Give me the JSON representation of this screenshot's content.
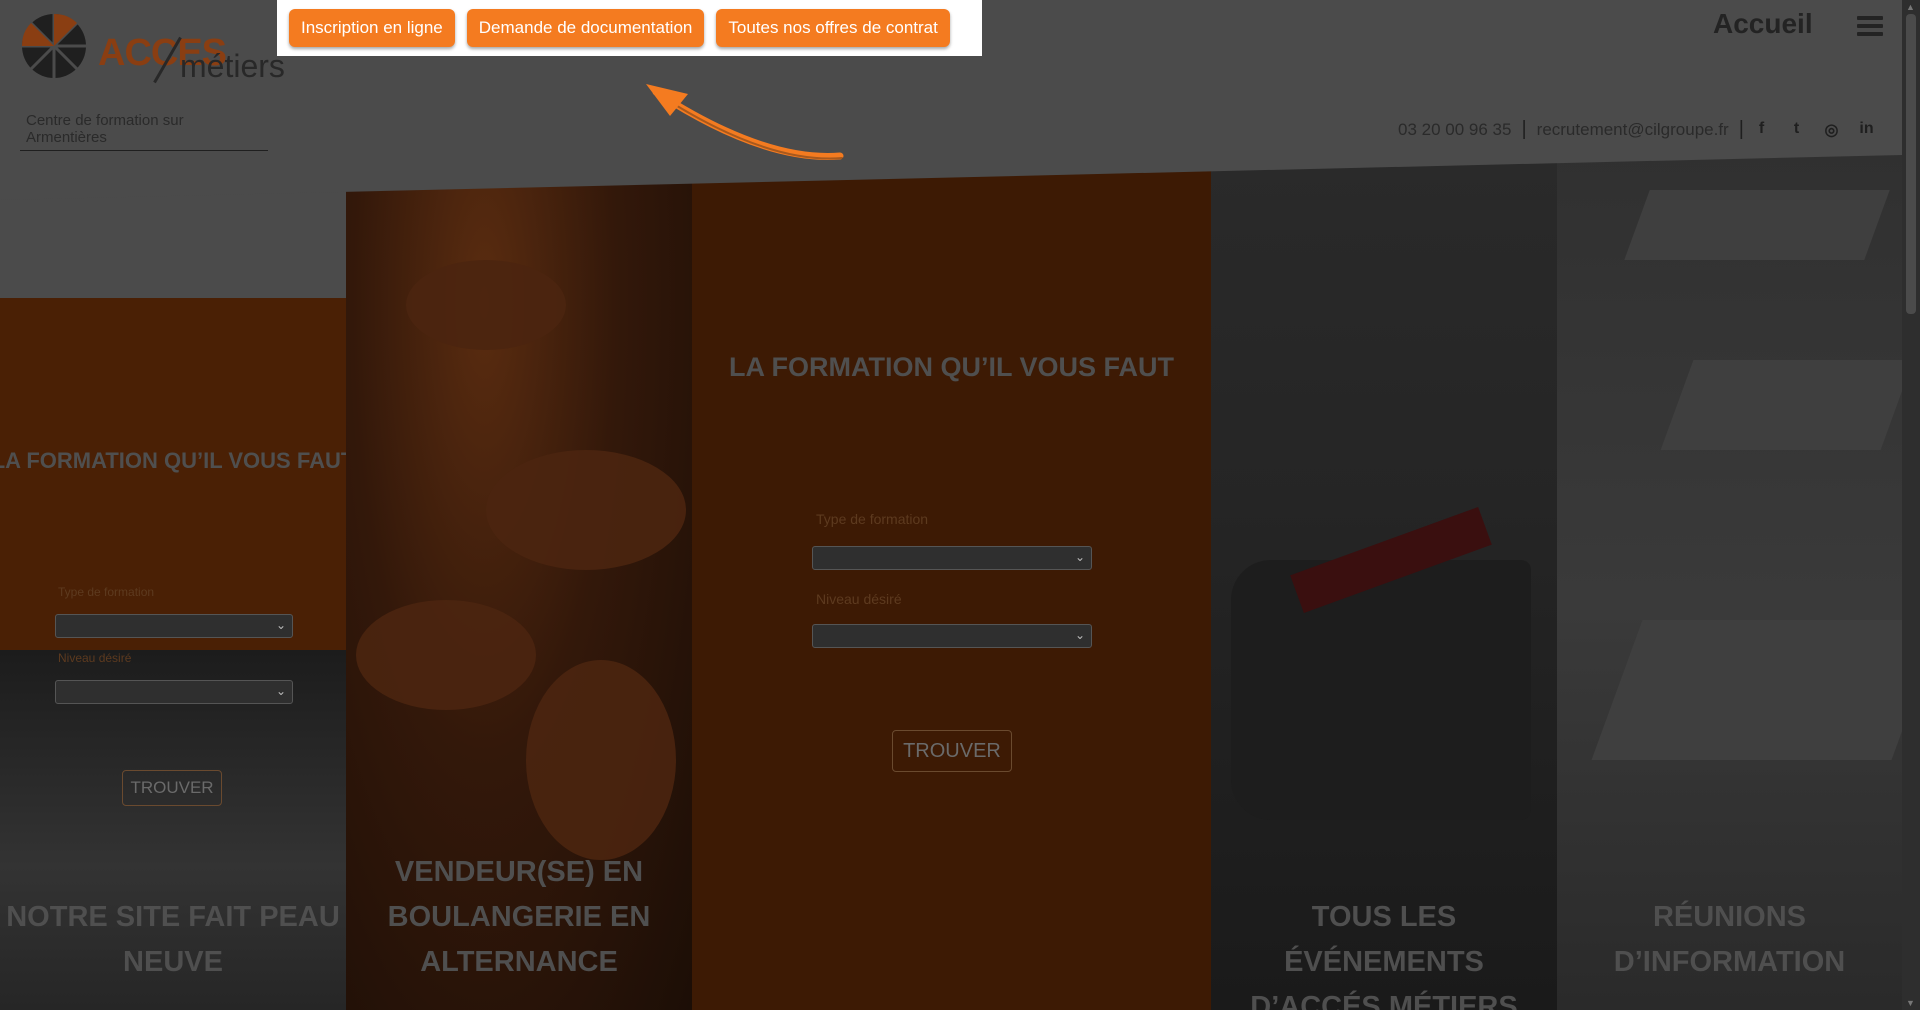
{
  "header": {
    "logo_acces": "ACCES",
    "logo_metiers": "métiers",
    "center_label": "Centre de formation sur Armentières",
    "nav_title": "Accueil",
    "phone": "03 20 00 96 35",
    "email": "recrutement@cilgroupe.fr"
  },
  "top_buttons": [
    "Inscription en ligne",
    "Demande de documentation",
    "Toutes nos offres de contrat"
  ],
  "socials": [
    {
      "icon": "facebook-icon",
      "glyph": "f"
    },
    {
      "icon": "twitter-icon",
      "glyph": "t"
    },
    {
      "icon": "instagram-icon",
      "glyph": "◎"
    },
    {
      "icon": "linkedin-icon",
      "glyph": "in"
    }
  ],
  "form": {
    "title": "LA FORMATION QU’IL VOUS FAUT",
    "type_label": "Type de formation",
    "niveau_label": "Niveau désiré",
    "button": "TROUVER"
  },
  "panels": [
    {
      "title_line1": "NOTRE SITE FAIT PEAU",
      "title_line2": "NEUVE"
    },
    {
      "title_line1": "VENDEUR(SE) EN",
      "title_line2": "BOULANGERIE EN",
      "title_line3": "ALTERNANCE"
    },
    {
      "title_line1": "TOUS LES ÉVÉNEMENTS",
      "title_line2": "D’ACCÉS MÉTIERS"
    },
    {
      "title_line1": "RÉUNIONS",
      "title_line2": "D’INFORMATION"
    }
  ],
  "colors": {
    "accent": "#f47b20",
    "overlay": "#3a3a3a"
  }
}
